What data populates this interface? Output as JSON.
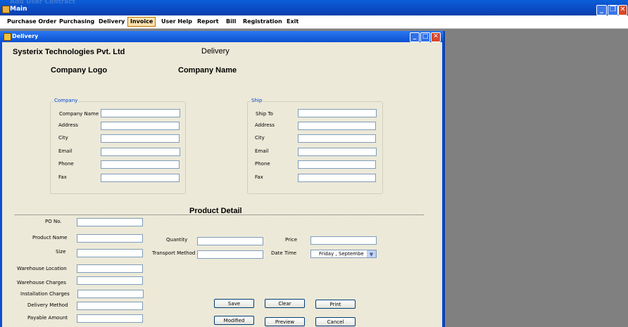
{
  "main_window": {
    "ghost_title": "Add User Contract",
    "title": "Main"
  },
  "menu": {
    "items": [
      "Purchase Order",
      "Purchasing",
      "Delivery",
      "Invoice",
      "User Help",
      "Report",
      "Bill",
      "Registration",
      "Exit"
    ],
    "active": "Invoice"
  },
  "child_window": {
    "title": "Delivery"
  },
  "header": {
    "company": "Systerix Technologies Pvt. Ltd",
    "form_name": "Delivery",
    "logo_label": "Company Logo",
    "name_label": "Company Name"
  },
  "company_group": {
    "title": "Company",
    "fields": [
      "Company Name",
      "Address",
      "City",
      "Email",
      "Phone",
      "Fax"
    ]
  },
  "ship_group": {
    "title": "Ship",
    "fields": [
      "Ship To",
      "Address",
      "City",
      "Email",
      "Phone",
      "Fax"
    ]
  },
  "product": {
    "heading": "Product Detail",
    "left_fields": [
      "PO No.",
      "Product Name",
      "Size",
      "Warehouse Location",
      "Warehouse Charges",
      "Installation Charges",
      "Delivery Method",
      "Payable Amount"
    ],
    "quantity_label": "Quantity",
    "transport_label": "Transport Method",
    "price_label": "Price",
    "datetime_label": "Date  Time",
    "date_value": "Friday     , Septembe"
  },
  "buttons": {
    "save": "Save",
    "clear": "Clear",
    "print": "Print",
    "modified": "Modified",
    "preview": "Preview",
    "cancel": "Cancel"
  }
}
